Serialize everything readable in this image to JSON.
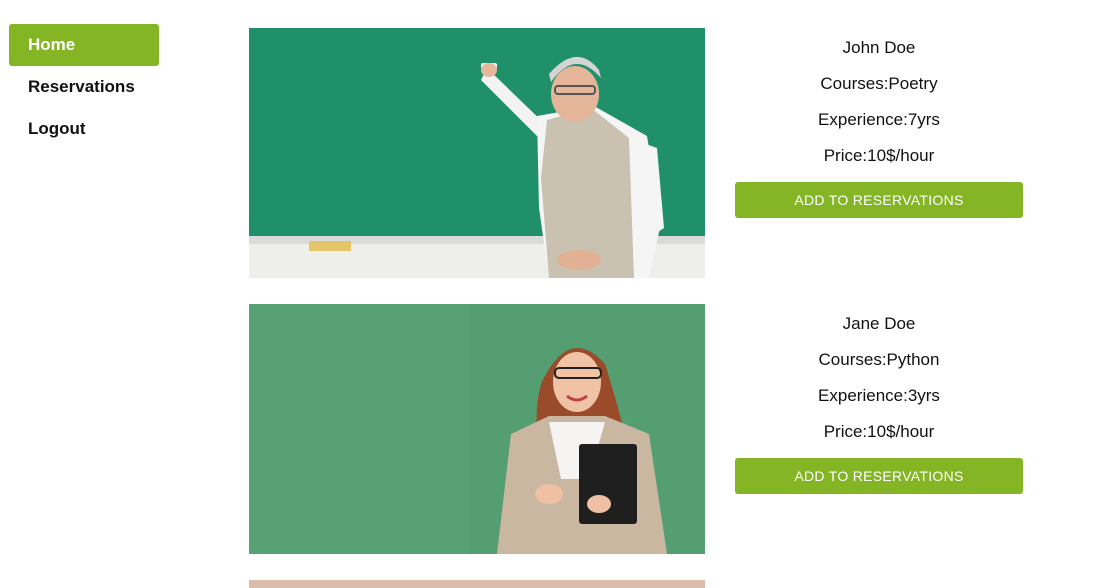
{
  "sidebar": {
    "items": [
      {
        "label": "Home",
        "active": true
      },
      {
        "label": "Reservations",
        "active": false
      },
      {
        "label": "Logout",
        "active": false
      }
    ]
  },
  "teachers": [
    {
      "name": "John Doe",
      "courses": "Courses:Poetry",
      "experience": "Experience:7yrs",
      "price": "Price:10$/hour",
      "button_label": "ADD TO RESERVATIONS"
    },
    {
      "name": "Jane Doe",
      "courses": "Courses:Python",
      "experience": "Experience:3yrs",
      "price": "Price:10$/hour",
      "button_label": "ADD TO RESERVATIONS"
    }
  ],
  "colors": {
    "accent": "#84b525",
    "chalkboard": "#1f8a62",
    "backdrop_green": "#559e71"
  }
}
